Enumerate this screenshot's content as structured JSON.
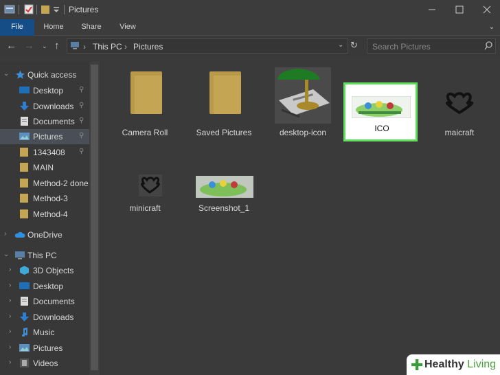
{
  "window": {
    "title": "Pictures"
  },
  "ribbon": {
    "tabs": [
      "File",
      "Home",
      "Share",
      "View"
    ]
  },
  "address": {
    "segments": [
      "This PC",
      "Pictures"
    ],
    "search_placeholder": "Search Pictures"
  },
  "nav": {
    "quick_access": "Quick access",
    "quick_items": [
      "Desktop",
      "Downloads",
      "Documents",
      "Pictures",
      "1343408",
      "MAIN",
      "Method-2 done",
      "Method-3",
      "Method-4"
    ],
    "onedrive": "OneDrive",
    "this_pc": "This PC",
    "pc_items": [
      "3D Objects",
      "Desktop",
      "Documents",
      "Downloads",
      "Music",
      "Pictures",
      "Videos"
    ]
  },
  "files": [
    {
      "name": "Camera Roll",
      "type": "folder"
    },
    {
      "name": "Saved Pictures",
      "type": "folder"
    },
    {
      "name": "desktop-icon",
      "type": "image"
    },
    {
      "name": "ICO",
      "type": "image",
      "selected": true
    },
    {
      "name": "maicraft",
      "type": "image"
    },
    {
      "name": "minicraft",
      "type": "image"
    },
    {
      "name": "Screenshot_1",
      "type": "image"
    }
  ],
  "colors": {
    "file_tab": "#154d86",
    "selection_border": "#5ee05a",
    "brand_green": "#3a9b3a"
  },
  "watermark": {
    "brand": "Healthy",
    "brand2": "Living"
  }
}
